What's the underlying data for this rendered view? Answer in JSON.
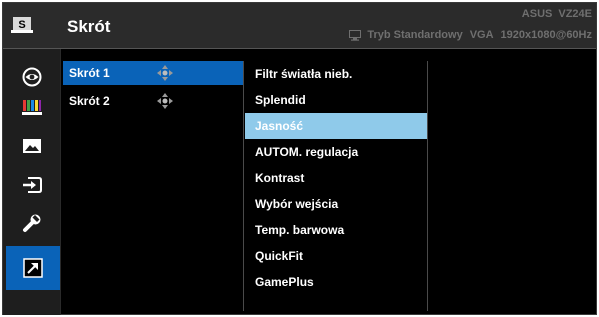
{
  "header": {
    "title": "Skrót",
    "brand": "ASUS",
    "model": "VZ24E",
    "mode": "Tryb Standardowy",
    "input": "VGA",
    "resolution": "1920x1080@60Hz"
  },
  "sidebar": {
    "icons": [
      "splendid-icon",
      "eye-care-icon",
      "color-bars-icon",
      "image-icon",
      "input-select-icon",
      "wrench-icon",
      "shortcut-arrow-icon"
    ],
    "active": "shortcut-arrow-icon"
  },
  "shortcuts": {
    "items": [
      {
        "label": "Skrót 1",
        "selected": true
      },
      {
        "label": "Skrót 2",
        "selected": false
      }
    ]
  },
  "options": {
    "items": [
      {
        "label": "Filtr światła nieb."
      },
      {
        "label": "Splendid"
      },
      {
        "label": "Jasność",
        "highlighted": true
      },
      {
        "label": "AUTOM. regulacja"
      },
      {
        "label": "Kontrast"
      },
      {
        "label": "Wybór wejścia"
      },
      {
        "label": "Temp. barwowa"
      },
      {
        "label": "QuickFit"
      },
      {
        "label": "GamePlus"
      }
    ]
  },
  "colors": {
    "accent": "#0a63b8",
    "highlight": "#8fcaea",
    "background": "#000000"
  }
}
